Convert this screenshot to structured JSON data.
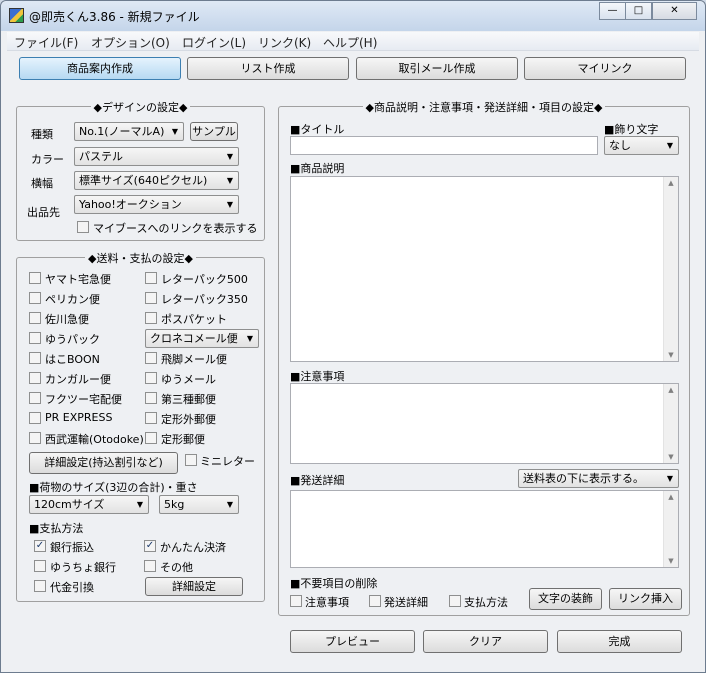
{
  "window": {
    "title": "@即売くん3.86 - 新規ファイル",
    "minimize": "—",
    "maximize": "□",
    "close": "✕"
  },
  "menu": [
    "ファイル(F)",
    "オプション(O)",
    "ログイン(L)",
    "リンク(K)",
    "ヘルプ(H)"
  ],
  "tabs": [
    "商品案内作成",
    "リスト作成",
    "取引メール作成",
    "マイリンク"
  ],
  "design": {
    "title": "◆デザインの設定◆",
    "kind_label": "種類",
    "kind_value": "No.1(ノーマルA)",
    "sample_button": "サンプル",
    "color_label": "カラー",
    "color_value": "パステル",
    "width_label": "横幅",
    "width_value": "標準サイズ(640ピクセル)",
    "site_label": "出品先",
    "site_value": "Yahoo!オークション",
    "mybooth_link": "マイブースへのリンクを表示する"
  },
  "shipping": {
    "title": "◆送料・支払の設定◆",
    "left": [
      "ヤマト宅急便",
      "ペリカン便",
      "佐川急便",
      "ゆうパック",
      "はこBOON",
      "カンガルー便",
      "フクツー宅配便",
      "PR EXPRESS",
      "西武運輸(Otodoke)"
    ],
    "right": [
      "レターパック500",
      "レターパック350",
      "ポスパケット"
    ],
    "dropdown": "クロネコメール便",
    "right2": [
      "飛脚メール便",
      "ゆうメール",
      "第三種郵便",
      "定形外郵便",
      "定形郵便"
    ],
    "detail_button": "詳細設定(持込割引など)",
    "mini_letter": "ミニレター",
    "size_label": "■荷物のサイズ(3辺の合計)・重さ",
    "size_value": "120cmサイズ",
    "weight_value": "5kg",
    "payment_label": "■支払方法",
    "payments": [
      "銀行振込",
      "かんたん決済",
      "ゆうちょ銀行",
      "その他",
      "代金引換"
    ],
    "payment_detail_button": "詳細設定"
  },
  "product": {
    "title": "◆商品説明・注意事項・発送詳細・項目の設定◆",
    "title_label": "■タイトル",
    "decor_label": "■飾り文字",
    "decor_value": "なし",
    "desc_label": "■商品説明",
    "notes_label": "■注意事項",
    "ship_label": "■発送詳細",
    "ship_dropdown": "送料表の下に表示する。",
    "remove_label": "■不要項目の削除",
    "remove_items": [
      "注意事項",
      "発送詳細",
      "支払方法"
    ],
    "text_decor_button": "文字の装飾",
    "link_insert_button": "リンク挿入"
  },
  "footer": {
    "preview": "プレビュー",
    "clear": "クリア",
    "done": "完成"
  },
  "icons": {
    "check": "✓",
    "arrow": "▼",
    "scroll_up": "▲",
    "scroll_down": "▼"
  }
}
